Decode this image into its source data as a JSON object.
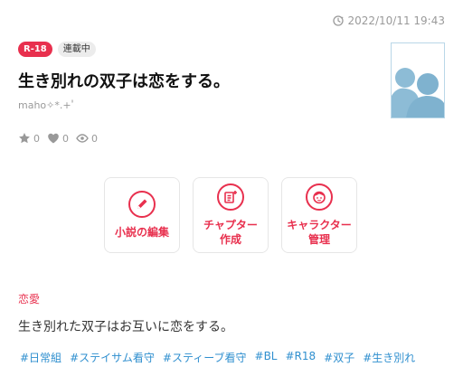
{
  "header": {
    "updated_at": "2022/10/11 19:43"
  },
  "badges": {
    "rating": "R-18",
    "status": "連載中"
  },
  "novel": {
    "title": "生き別れの双子は恋をする。",
    "author": "maho✧*.+ﾟ",
    "stats": {
      "stars": "0",
      "likes": "0",
      "views": "0"
    },
    "genre": "恋愛",
    "summary": "生き別れた双子はお互いに恋をする。",
    "tags": [
      "#日常組",
      "#ステイサム看守",
      "#スティーブ看守",
      "#BL",
      "#R18",
      "#双子",
      "#生き別れ"
    ]
  },
  "actions": {
    "edit_novel": "小説の編集",
    "create_chapter": "チャプター\n作成",
    "manage_characters": "キャラクター\n管理"
  },
  "colors": {
    "accent": "#e8304e",
    "tag": "#2f8fcf",
    "muted": "#9a9a9a",
    "cover_tint": "#8dbcd6"
  },
  "icons": [
    "clock-icon",
    "star-icon",
    "heart-icon",
    "eye-icon",
    "pencil-icon",
    "add-chapter-icon",
    "character-face-icon"
  ]
}
